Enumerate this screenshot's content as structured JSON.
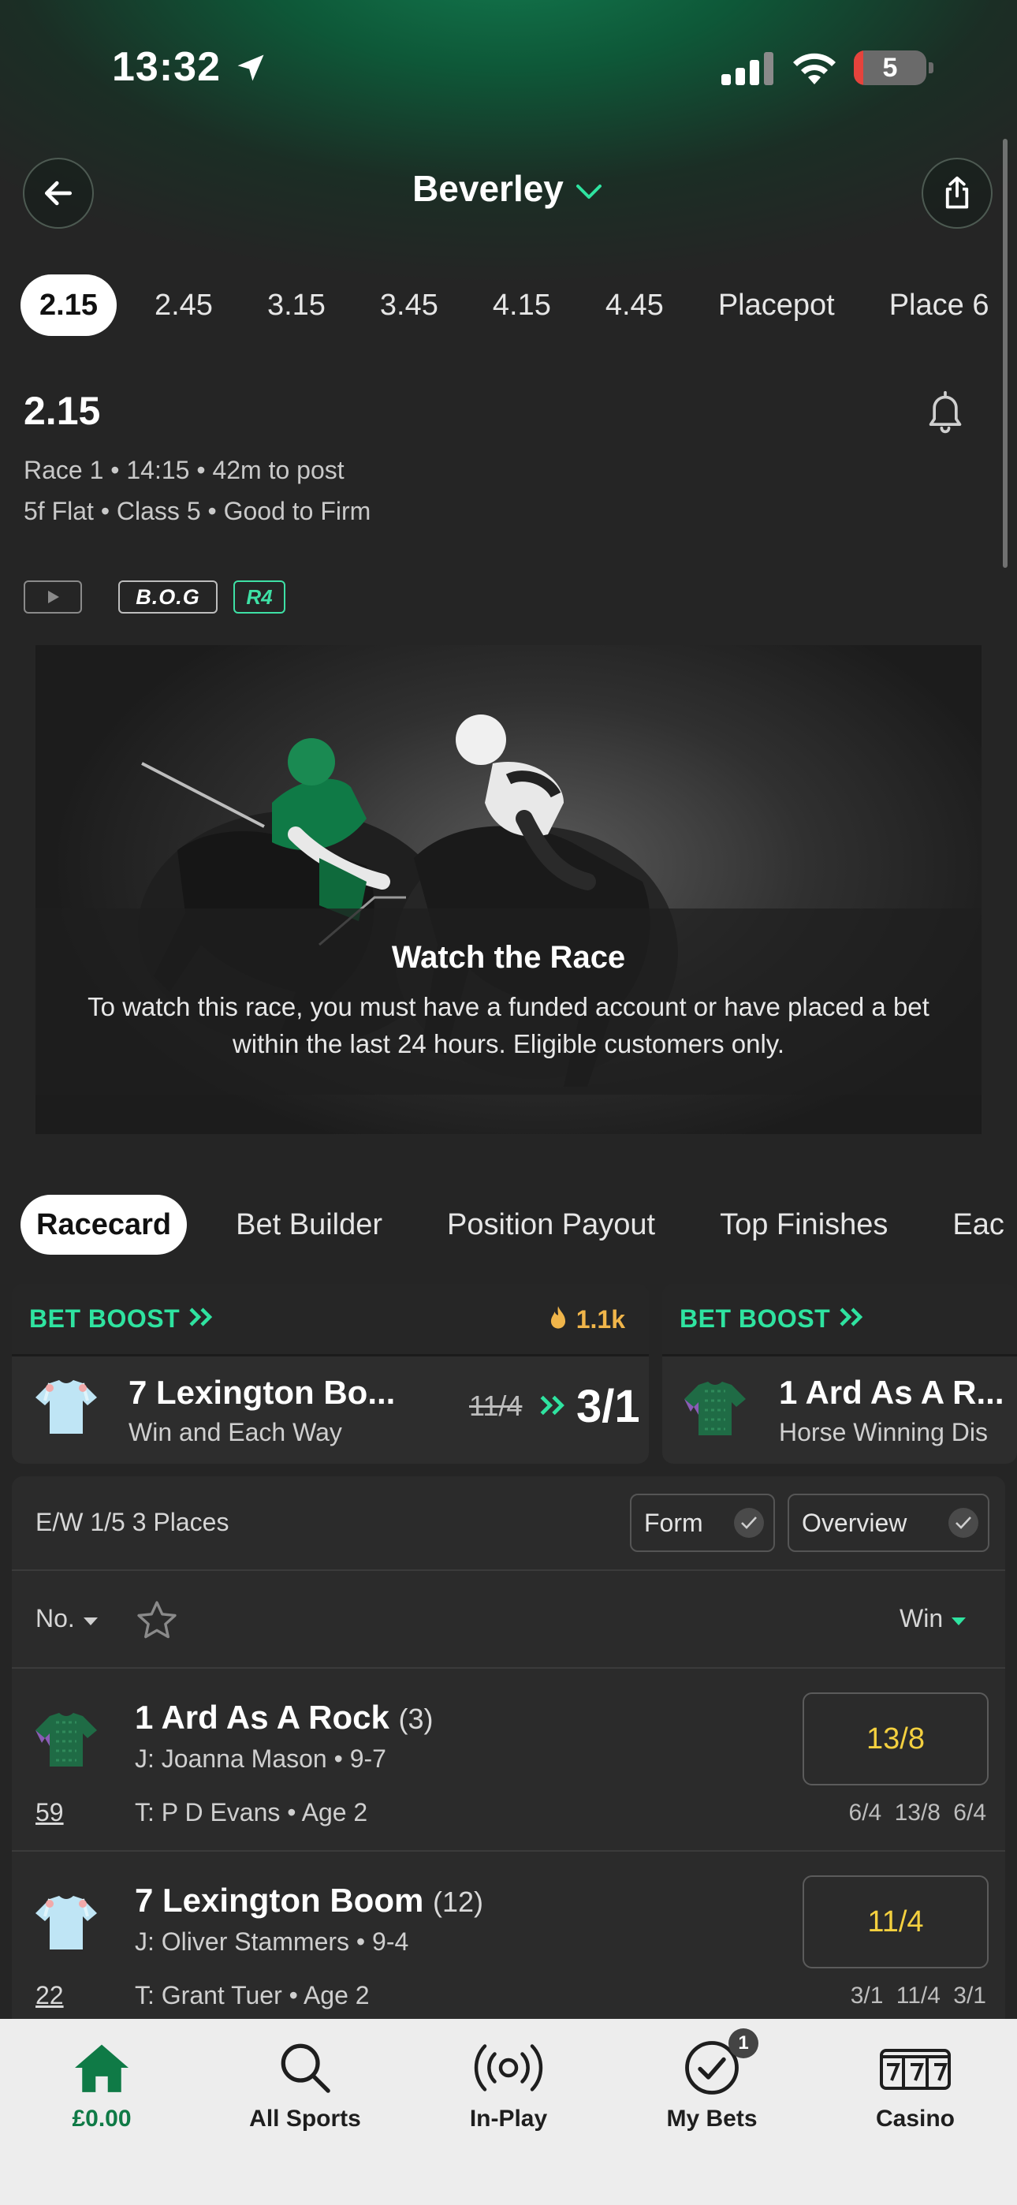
{
  "status_bar": {
    "time": "13:32",
    "battery": "5"
  },
  "header": {
    "venue": "Beverley"
  },
  "race_tabs": [
    "2.15",
    "2.45",
    "3.15",
    "3.45",
    "4.15",
    "4.45",
    "Placepot",
    "Place 6"
  ],
  "race": {
    "title": "2.15",
    "meta": "Race 1 • 14:15 • 42m to post",
    "details": "5f Flat  • Class 5  • Good to Firm",
    "badges": {
      "bog": "B.O.G",
      "r4": "R4"
    }
  },
  "stream": {
    "title": "Watch the Race",
    "message": "To watch this race, you must have a funded account or have placed a bet within the last 24 hours. Eligible customers only."
  },
  "content_tabs": [
    "Racecard",
    "Bet Builder",
    "Position Payout",
    "Top Finishes",
    "Eac"
  ],
  "boosts": [
    {
      "label": "BET BOOST",
      "popularity": "1.1k",
      "name": "7  Lexington Bo...",
      "subtitle": "Win and Each Way",
      "old_odds": "11/4",
      "new_odds": "3/1"
    },
    {
      "label": "BET BOOST",
      "name": "1  Ard As A R...",
      "subtitle": "Horse Winning Dis"
    }
  ],
  "racecard": {
    "ew_terms": "E/W 1/5 3 Places",
    "toggles": {
      "form": "Form",
      "overview": "Overview"
    },
    "sort_label": "No.",
    "price_label": "Win",
    "runners": [
      {
        "number_name": "1  Ard As A Rock",
        "draw": "(3)",
        "jockey": "J: Joanna Mason • 9-7",
        "trainer": "T: P D Evans • Age 2",
        "rating": "59",
        "odds": "13/8",
        "history": "6/4 13/8 6/4"
      },
      {
        "number_name": "7  Lexington Boom",
        "draw": "(12)",
        "jockey": "J: Oliver Stammers • 9-4",
        "trainer": "T: Grant Tuer • Age 2",
        "rating": "22",
        "odds": "11/4",
        "history": "3/1 11/4 3/1"
      }
    ]
  },
  "tabbar": {
    "home": "£0.00",
    "sports": "All Sports",
    "inplay": "In-Play",
    "mybets": "My Bets",
    "mybets_count": "1",
    "casino": "Casino"
  },
  "colors": {
    "brand_green": "#0f7a46",
    "boost_green": "#2fe3a0",
    "odds_yellow": "#f4d03f",
    "hot_orange": "#f0b54a"
  }
}
